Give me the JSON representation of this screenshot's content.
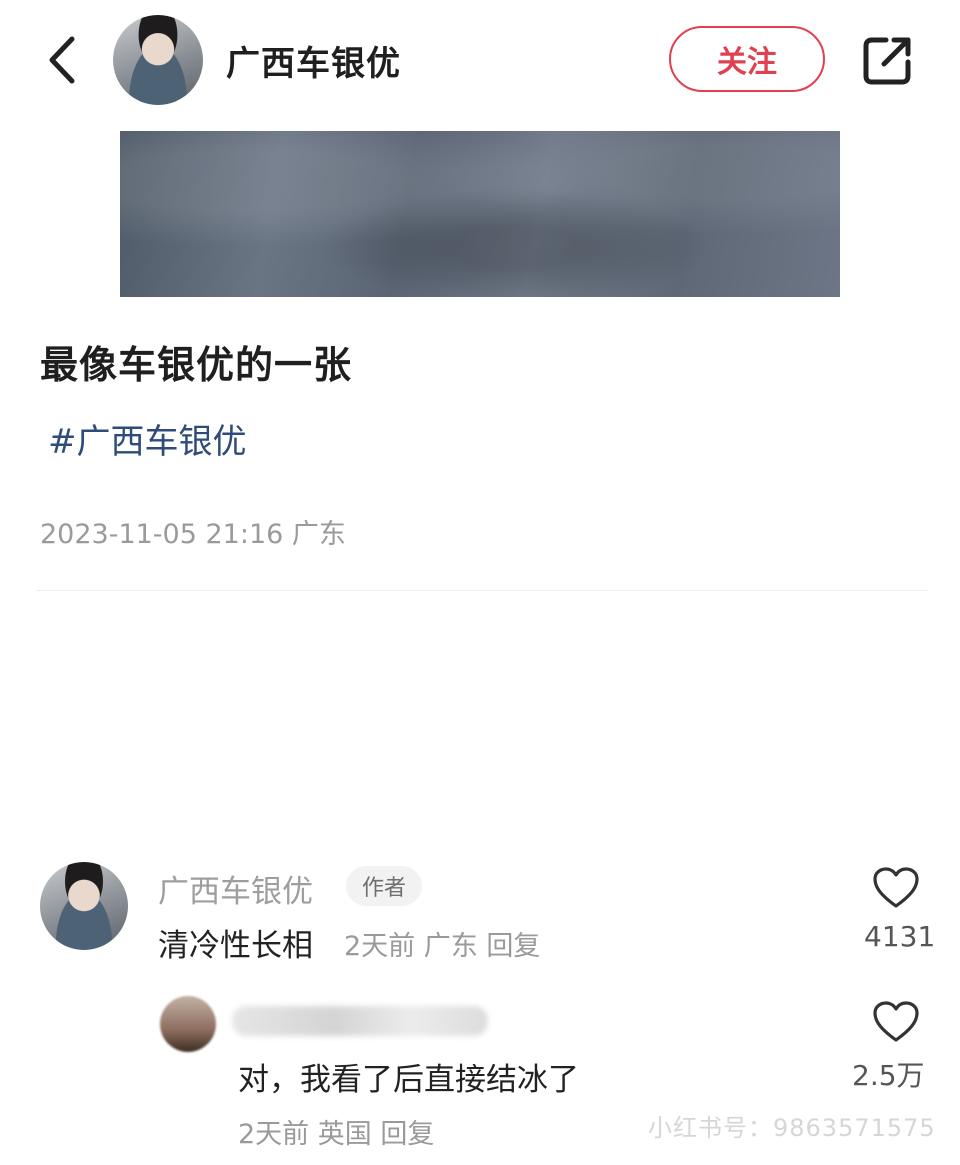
{
  "header": {
    "user_name": "广西车银优",
    "follow_label": "关注"
  },
  "post": {
    "title": "最像车银优的一张",
    "tag": "#广西车银优",
    "meta": "2023-11-05 21:16 广东"
  },
  "comments": [
    {
      "author": "广西车银优",
      "badge": "作者",
      "text": "清冷性长相",
      "time": "2天前",
      "location": "广东",
      "reply_label": "回复",
      "likes": "4131"
    }
  ],
  "reply": {
    "text": "对，我看了后直接结冰了",
    "time": "2天前",
    "location": "英国",
    "reply_label": "回复",
    "likes": "2.5万"
  },
  "watermark": "小红书号：9863571575",
  "icons": {
    "back": "chevron-left-icon",
    "share": "share-icon",
    "like": "heart-icon"
  }
}
